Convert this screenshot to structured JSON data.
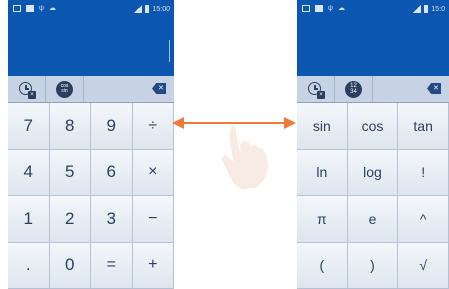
{
  "left_screen": {
    "status_time": "15:00",
    "toolbar": {
      "history_icon": "history-clear-icon",
      "mode_icon": "advanced-functions-icon",
      "mode_label_top": "cos",
      "mode_label_bottom": "sin"
    },
    "keys": [
      "7",
      "8",
      "9",
      "÷",
      "4",
      "5",
      "6",
      "×",
      "1",
      "2",
      "3",
      "−",
      ".",
      "0",
      "=",
      "+"
    ]
  },
  "right_screen": {
    "status_time": "15:0",
    "toolbar": {
      "history_icon": "history-clear-icon",
      "mode_icon": "basic-numbers-icon",
      "mode_label_top": "12",
      "mode_label_bottom": "34"
    },
    "keys": [
      "sin",
      "cos",
      "tan",
      "ln",
      "log",
      "!",
      "π",
      "e",
      "^",
      "(",
      ")",
      "√"
    ]
  },
  "gesture": {
    "icon": "swipe-hand-icon",
    "arrow_color": "#f07a3a"
  },
  "colors": {
    "display_bg": "#0a56b0",
    "toolbar_bg": "#c7d3e4",
    "key_text": "#2d3f5e"
  }
}
